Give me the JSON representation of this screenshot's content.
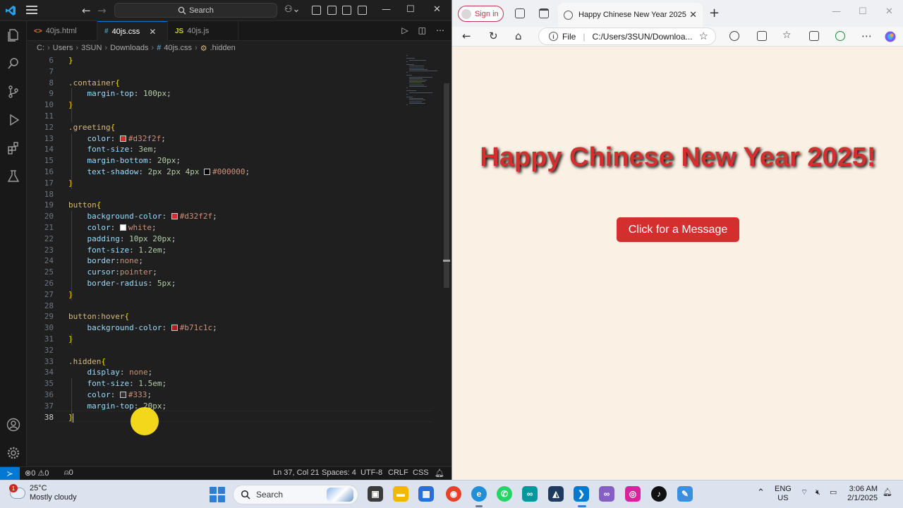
{
  "vscode": {
    "search_label": "Search",
    "tabs": [
      {
        "badge": "<>",
        "label": "40js.html"
      },
      {
        "badge": "#",
        "label": "40js.css"
      },
      {
        "badge": "JS",
        "label": "40js.js"
      }
    ],
    "breadcrumb": {
      "drive": "C:",
      "parts": [
        "Users",
        "3SUN",
        "Downloads"
      ],
      "file": "40js.css",
      "symbol": ".hidden"
    },
    "lines": [
      {
        "n": "6",
        "text": "}"
      },
      {
        "n": "7",
        "text": ""
      },
      {
        "n": "8",
        "text": ".container{"
      },
      {
        "n": "9",
        "text": "    margin-top: 100px;"
      },
      {
        "n": "10",
        "text": "}"
      },
      {
        "n": "11",
        "text": ""
      },
      {
        "n": "12",
        "text": ".greeting{"
      },
      {
        "n": "13",
        "text": "    color: #d32f2f;"
      },
      {
        "n": "14",
        "text": "    font-size: 3em;"
      },
      {
        "n": "15",
        "text": "    margin-bottom: 20px;"
      },
      {
        "n": "16",
        "text": "    text-shadow: 2px 2px 4px #000000;"
      },
      {
        "n": "17",
        "text": "}"
      },
      {
        "n": "18",
        "text": ""
      },
      {
        "n": "19",
        "text": "button{"
      },
      {
        "n": "20",
        "text": "    background-color: #d32f2f;"
      },
      {
        "n": "21",
        "text": "    color: white;"
      },
      {
        "n": "22",
        "text": "    padding: 10px 20px;"
      },
      {
        "n": "23",
        "text": "    font-size: 1.2em;"
      },
      {
        "n": "24",
        "text": "    border:none;"
      },
      {
        "n": "25",
        "text": "    cursor:pointer;"
      },
      {
        "n": "26",
        "text": "    border-radius: 5px;"
      },
      {
        "n": "27",
        "text": "}"
      },
      {
        "n": "28",
        "text": ""
      },
      {
        "n": "29",
        "text": "button:hover{"
      },
      {
        "n": "30",
        "text": "    background-color: #b71c1c;"
      },
      {
        "n": "31",
        "text": "}"
      },
      {
        "n": "32",
        "text": ""
      },
      {
        "n": "33",
        "text": ".hidden{"
      },
      {
        "n": "34",
        "text": "    display: none;"
      },
      {
        "n": "35",
        "text": "    font-size: 1.5em;"
      },
      {
        "n": "36",
        "text": "    color: #333;"
      },
      {
        "n": "37",
        "text": "    margin-top: 20px;"
      },
      {
        "n": "38",
        "text": "}"
      }
    ],
    "status": {
      "errors": "0",
      "warnings": "0",
      "ports": "0",
      "position": "Ln 37, Col 21",
      "spaces": "Spaces: 4",
      "encoding": "UTF-8",
      "eol": "CRLF",
      "language": "CSS"
    }
  },
  "browser": {
    "signin_label": "Sign in",
    "tab_title": "Happy Chinese New Year 2025",
    "address_scheme": "File",
    "address_url": "C:/Users/3SUN/Downloa...",
    "page": {
      "greeting": "Happy Chinese New Year 2025!",
      "button_label": "Click for a Message"
    }
  },
  "taskbar": {
    "temperature": "25°C",
    "weather": "Mostly cloudy",
    "weather_badge": "1",
    "search_label": "Search",
    "language": "ENG",
    "region": "US",
    "time": "3:06 AM",
    "date": "2/1/2025"
  },
  "colors": {
    "greeting": "#d32f2f",
    "button": "#d32f2f",
    "page_bg": "#faf0e3",
    "vscode_accent": "#0078d4"
  }
}
